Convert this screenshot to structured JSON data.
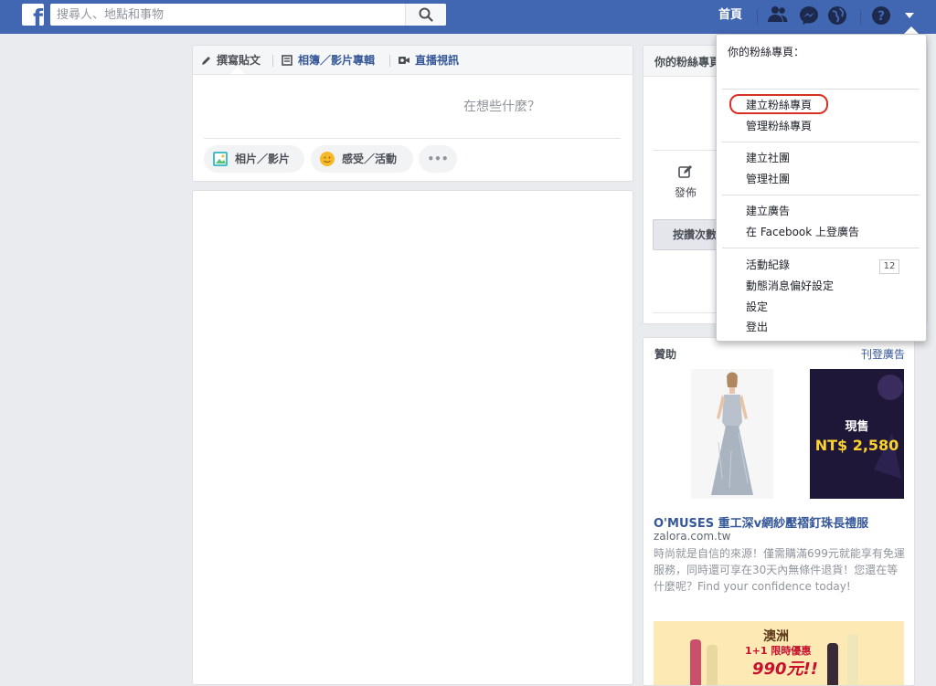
{
  "topbar": {
    "logo": "f",
    "search_placeholder": "搜尋人、地點和事物",
    "home_label": "首頁",
    "icons": [
      "friends-icon",
      "messenger-icon",
      "globe-notifications-icon",
      "help-icon",
      "menu-caret-icon"
    ]
  },
  "composer": {
    "tabs": [
      {
        "label": "撰寫貼文",
        "icon": "pencil-icon"
      },
      {
        "label": "相簿／影片專輯",
        "icon": "album-icon"
      },
      {
        "label": "直播視訊",
        "icon": "video-camera-icon"
      }
    ],
    "prompt": "在想些什麼？",
    "actions": [
      {
        "label": "相片／影片",
        "icon": "photo-icon"
      },
      {
        "label": "感受／活動",
        "icon": "smiley-icon"
      },
      {
        "label": "•••",
        "icon": "more-icon"
      }
    ]
  },
  "right_panel": {
    "title": "你的粉絲專頁",
    "post_label": "發佈",
    "button_label": "按讚次數"
  },
  "sponsored": {
    "title": "贊助",
    "create_ad_link": "刊登廣告",
    "ad1": {
      "title": "O'MUSES 重工深v網紗壓褶釘珠長禮服",
      "domain": "zalora.com.tw",
      "description": "時尚就是自信的來源！僅需購滿699元就能享有免運服務，同時還可享在30天內無條件退貨！您還在等什麼呢？Find your confidence today!",
      "image2_now": "現售",
      "image2_price": "NT$ 2,580"
    },
    "ad2": {
      "title": "澳洲",
      "promo": "1+1 限時優惠",
      "price": "990元!!"
    }
  },
  "dropdown": {
    "header": "你的粉絲專頁：",
    "items": [
      "建立粉絲專頁",
      "管理粉絲專頁",
      "建立社團",
      "管理社團",
      "建立廣告",
      "在 Facebook 上登廣告",
      "活動紀錄",
      "動態消息偏好設定",
      "設定",
      "登出"
    ],
    "activity_count": "12"
  },
  "colors": {
    "brand_blue": "#4267b2",
    "link_blue": "#365899",
    "background": "#e9ebee",
    "highlight_red": "#d93025"
  }
}
